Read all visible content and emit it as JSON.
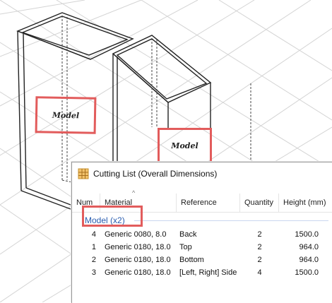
{
  "scene": {
    "model_labels": [
      "Model",
      "Model"
    ]
  },
  "window": {
    "title": "Cutting List (Overall Dimensions)",
    "icon": "grid-list-icon"
  },
  "columns": [
    "Num",
    "Material",
    "Reference",
    "Quantity",
    "Height (mm)"
  ],
  "group_label": "Model (x2)",
  "rows": [
    {
      "num": "4",
      "material": "Generic 0080, 8.0",
      "reference": "Back",
      "quantity": "2",
      "height": "1500.0"
    },
    {
      "num": "1",
      "material": "Generic 0180, 18.0",
      "reference": "Top",
      "quantity": "2",
      "height": "964.0"
    },
    {
      "num": "2",
      "material": "Generic 0180, 18.0",
      "reference": "Bottom",
      "quantity": "2",
      "height": "964.0"
    },
    {
      "num": "3",
      "material": "Generic 0180, 18.0",
      "reference": "[Left, Right] Side",
      "quantity": "4",
      "height": "1500.0"
    }
  ],
  "colors": {
    "highlight": "#e25c5c",
    "group_text": "#2a5db0"
  }
}
